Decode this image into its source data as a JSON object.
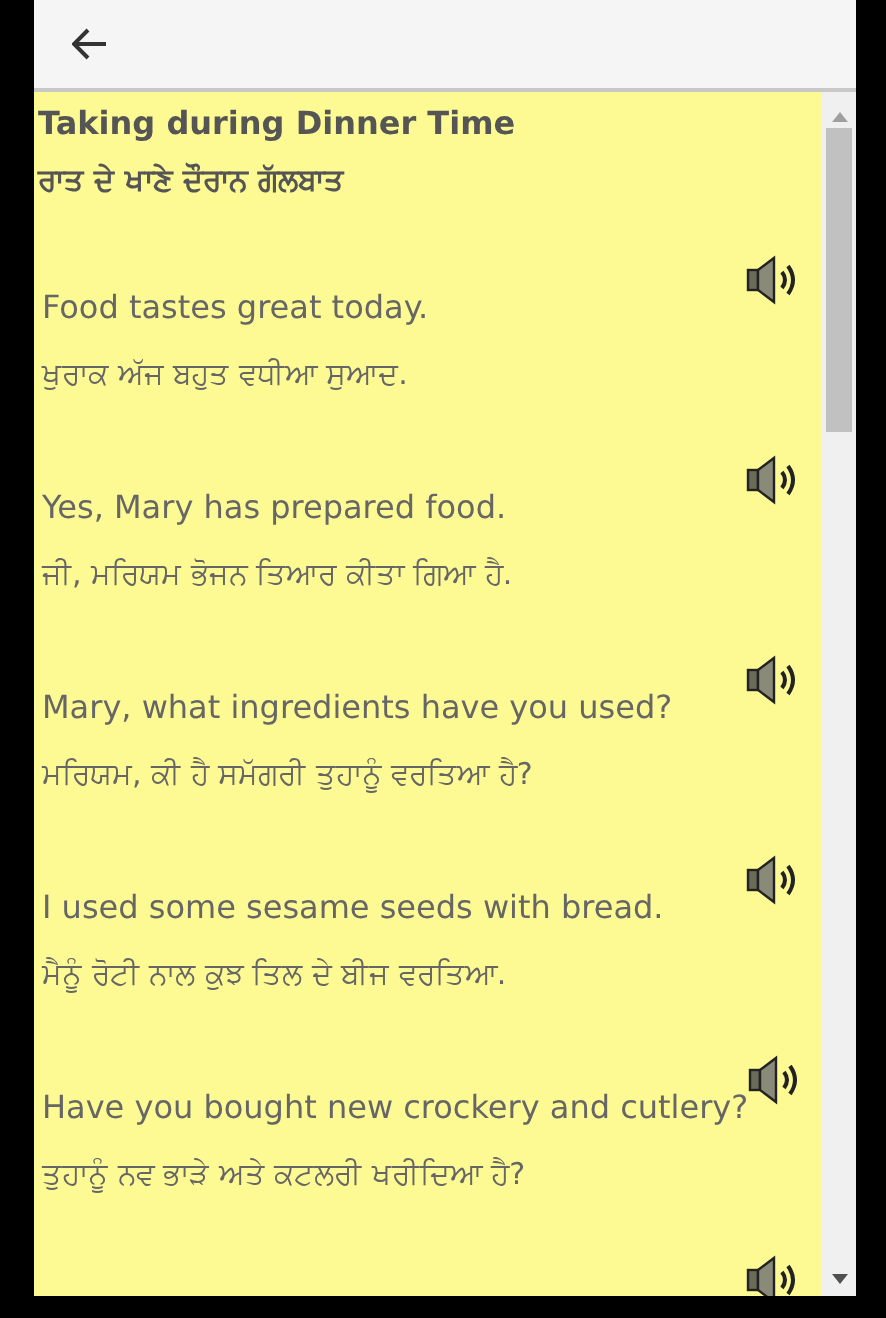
{
  "title": "Taking during Dinner Time",
  "title_translation": "ਰਾਤ ਦੇ ਖਾਣੇ ਦੌਰਾਨ ਗੱਲਬਾਤ",
  "phrases": [
    {
      "english": "Food tastes great today.",
      "punjabi": "ਖੁਰਾਕ ਅੱਜ ਬਹੁਤ ਵਧੀਆ ਸੁਆਦ."
    },
    {
      "english": "Yes, Mary has prepared food.",
      "punjabi": "ਜੀ, ਮਰਿਯਮ ਭੋਜਨ ਤਿਆਰ ਕੀਤਾ ਗਿਆ ਹੈ."
    },
    {
      "english": "Mary, what ingredients have you used?",
      "punjabi": "ਮਰਿਯਮ, ਕੀ ਹੈ ਸਮੱਗਰੀ ਤੁਹਾਨੂੰ ਵਰਤਿਆ ਹੈ?"
    },
    {
      "english": "I used some sesame seeds with bread.",
      "punjabi": "ਮੈਨੂੰ ਰੋਟੀ ਨਾਲ ਕੁਝ ਤਿਲ ਦੇ ਬੀਜ ਵਰਤਿਆ."
    },
    {
      "english": "Have you bought new crockery and cutlery?",
      "punjabi": "ਤੁਹਾਨੂੰ ਨਵ ਭਾੜੇ ਅਤੇ ਕਟਲਰੀ ਖਰੀਦਿਆ ਹੈ?"
    }
  ]
}
